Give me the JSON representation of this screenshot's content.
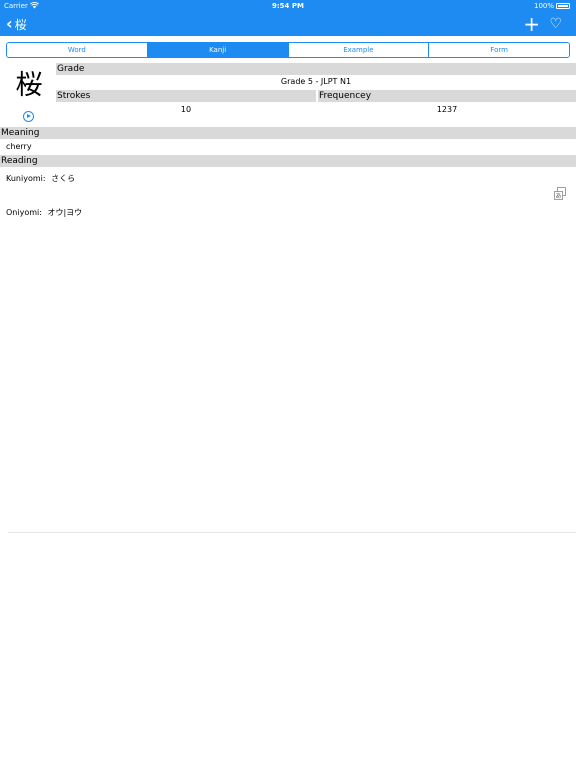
{
  "status_bar": {
    "carrier": "Carrier",
    "time": "9:54 PM",
    "battery": "100%"
  },
  "nav": {
    "back_label": "桜",
    "add_icon": "plus-icon",
    "favorite_icon": "heart-icon"
  },
  "tabs": [
    {
      "label": "Word",
      "active": false
    },
    {
      "label": "Kanji",
      "active": true
    },
    {
      "label": "Example",
      "active": false
    },
    {
      "label": "Form",
      "active": false
    }
  ],
  "kanji": {
    "character": "桜",
    "play_icon": "play-icon",
    "grade_header": "Grade",
    "grade_value": "Grade 5 - JLPT N1",
    "strokes_header": "Strokes",
    "strokes_value": "10",
    "frequency_header": "Frequencey",
    "frequency_value": "1237"
  },
  "meaning": {
    "header": "Meaning",
    "value": "cherry"
  },
  "reading": {
    "header": "Reading",
    "kun_label": "Kuniyomi:",
    "kun_value": "さくら",
    "on_label": "Oniyomi:",
    "on_value": "オウ|ヨウ",
    "copy_icon": "kana-copy-icon"
  },
  "colors": {
    "accent": "#1e8bf2",
    "header_bg": "#d9d9d9"
  }
}
